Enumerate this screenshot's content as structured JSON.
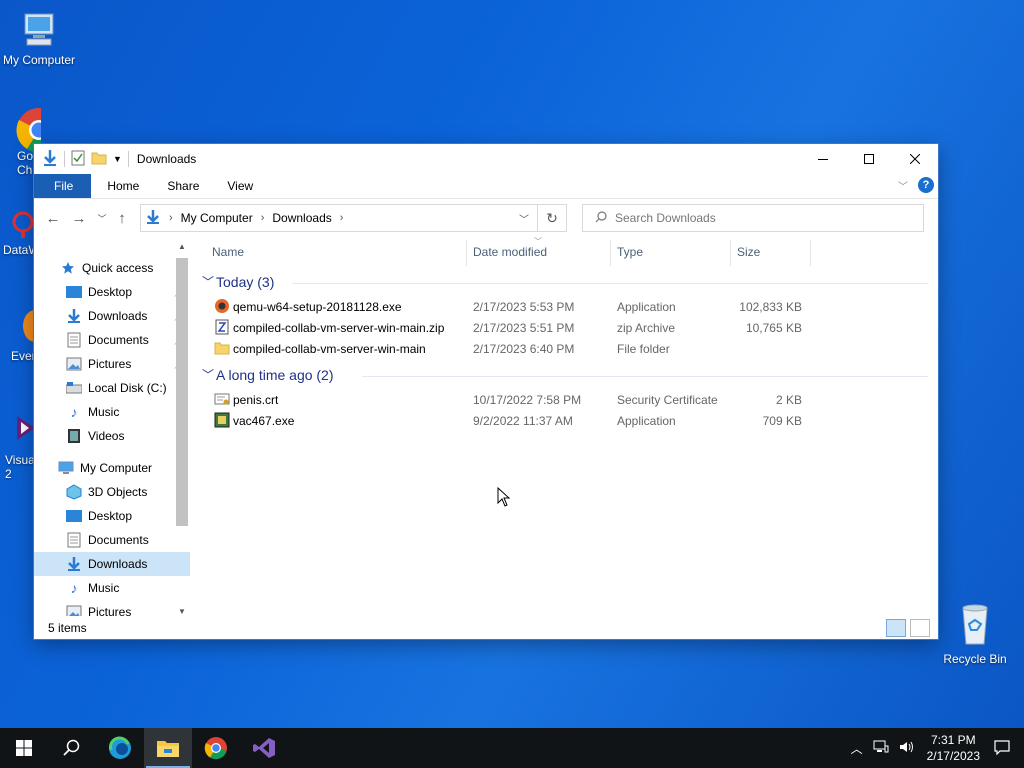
{
  "desktop": {
    "icons": [
      {
        "label": "My Computer"
      },
      {
        "label": "Go Ch"
      },
      {
        "label": "DataW"
      },
      {
        "label": "Ever"
      },
      {
        "label": "Visua 2"
      },
      {
        "label": "Recycle Bin"
      }
    ]
  },
  "window": {
    "title": "Downloads",
    "ribbon_tabs": [
      "File",
      "Home",
      "Share",
      "View"
    ],
    "help_label": "?",
    "breadcrumb": [
      "My Computer",
      "Downloads"
    ],
    "search_placeholder": "Search Downloads",
    "nav": {
      "quick_access": "Quick access",
      "qa_items": [
        "Desktop",
        "Downloads",
        "Documents",
        "Pictures",
        "Local Disk (C:)",
        "Music",
        "Videos"
      ],
      "my_computer": "My Computer",
      "mc_items": [
        "3D Objects",
        "Desktop",
        "Documents",
        "Downloads",
        "Music",
        "Pictures"
      ],
      "selected": "Downloads"
    },
    "columns": [
      "Name",
      "Date modified",
      "Type",
      "Size"
    ],
    "groups": [
      {
        "label": "Today (3)",
        "files": [
          {
            "name": "qemu-w64-setup-20181128.exe",
            "date": "2/17/2023 5:53 PM",
            "type": "Application",
            "size": "102,833 KB",
            "icon": "qemu-app-icon"
          },
          {
            "name": "compiled-collab-vm-server-win-main.zip",
            "date": "2/17/2023 5:51 PM",
            "type": "zip Archive",
            "size": "10,765 KB",
            "icon": "zip-archive-icon"
          },
          {
            "name": "compiled-collab-vm-server-win-main",
            "date": "2/17/2023 6:40 PM",
            "type": "File folder",
            "size": "",
            "icon": "folder-icon"
          }
        ]
      },
      {
        "label": "A long time ago (2)",
        "files": [
          {
            "name": "penis.crt",
            "date": "10/17/2022 7:58 PM",
            "type": "Security Certificate",
            "size": "2 KB",
            "icon": "certificate-icon"
          },
          {
            "name": "vac467.exe",
            "date": "9/2/2022 11:37 AM",
            "type": "Application",
            "size": "709 KB",
            "icon": "application-icon"
          }
        ]
      }
    ],
    "status": "5 items"
  },
  "taskbar": {
    "time": "7:31 PM",
    "date": "2/17/2023"
  }
}
